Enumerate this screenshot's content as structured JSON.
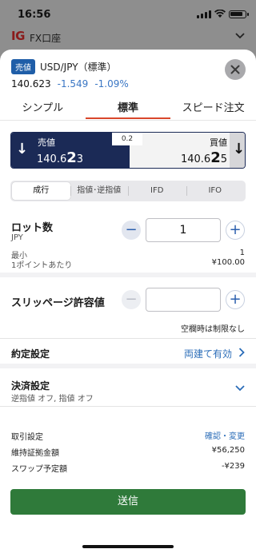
{
  "status": {
    "time": "16:56"
  },
  "app": {
    "logo": "IG",
    "account": "FX口座"
  },
  "symbol": {
    "side_tag": "売値",
    "name": "USD/JPY（標準）",
    "last": "140.623",
    "change": "-1.549",
    "change_pct": "-1.09%"
  },
  "tabs": [
    {
      "label": "シンプル"
    },
    {
      "label": "標準"
    },
    {
      "label": "スピード注文"
    }
  ],
  "quote": {
    "sell_label": "売値",
    "sell_prefix": "140.6",
    "sell_big": "2",
    "sell_suffix": "3",
    "spread": "0.2",
    "buy_label": "買値",
    "buy_prefix": "140.6",
    "buy_big": "2",
    "buy_suffix": "5"
  },
  "order_types": [
    {
      "label": "成行"
    },
    {
      "label": "指値･逆指値"
    },
    {
      "label": "IFD"
    },
    {
      "label": "IFO"
    }
  ],
  "lot": {
    "label": "ロット数",
    "currency": "JPY",
    "value": "1",
    "min_label": "最小",
    "min_value": "1",
    "per_point_label": "1ポイントあたり",
    "per_point_value": "¥100.00"
  },
  "slippage": {
    "label": "スリッページ許容値",
    "value": "",
    "note": "空欄時は制限なし"
  },
  "contract": {
    "label": "約定設定",
    "value": "両建て有効"
  },
  "settlement": {
    "label": "決済設定",
    "sub": "逆指値 オフ, 指値 オフ"
  },
  "info": {
    "trade_settings_label": "取引設定",
    "trade_settings_link": "確認・変更",
    "margin_label": "維持証拠金額",
    "margin_value": "¥56,250",
    "swap_label": "スワップ予定額",
    "swap_value": "-¥239"
  },
  "submit_label": "送信",
  "colors": {
    "accent": "#2b6db8",
    "sell_bg": "#1b2a56",
    "submit": "#2f7a3a",
    "tab_underline": "#d9472b"
  }
}
